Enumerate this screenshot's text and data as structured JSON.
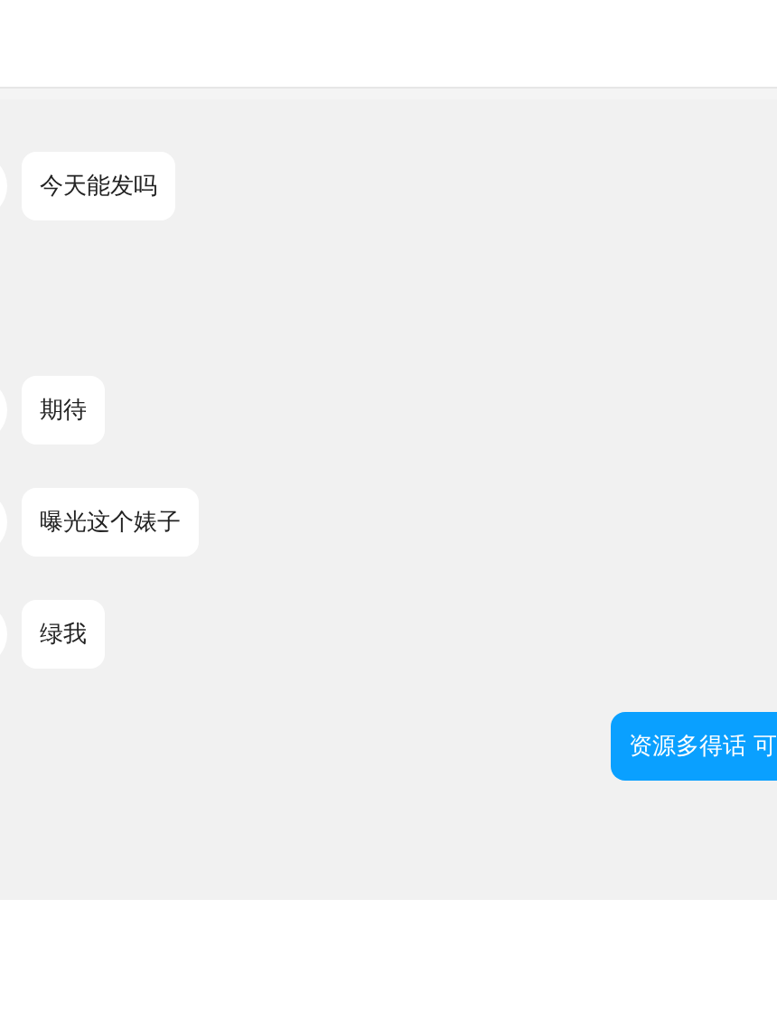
{
  "messages": [
    {
      "kind": "received",
      "text": "今天能发吗"
    },
    {
      "kind": "received",
      "text": "期待"
    },
    {
      "kind": "received",
      "text": "曝光这个婊子"
    },
    {
      "kind": "received",
      "text": "绿我"
    },
    {
      "kind": "sent",
      "text": "资源多得话 可"
    }
  ]
}
